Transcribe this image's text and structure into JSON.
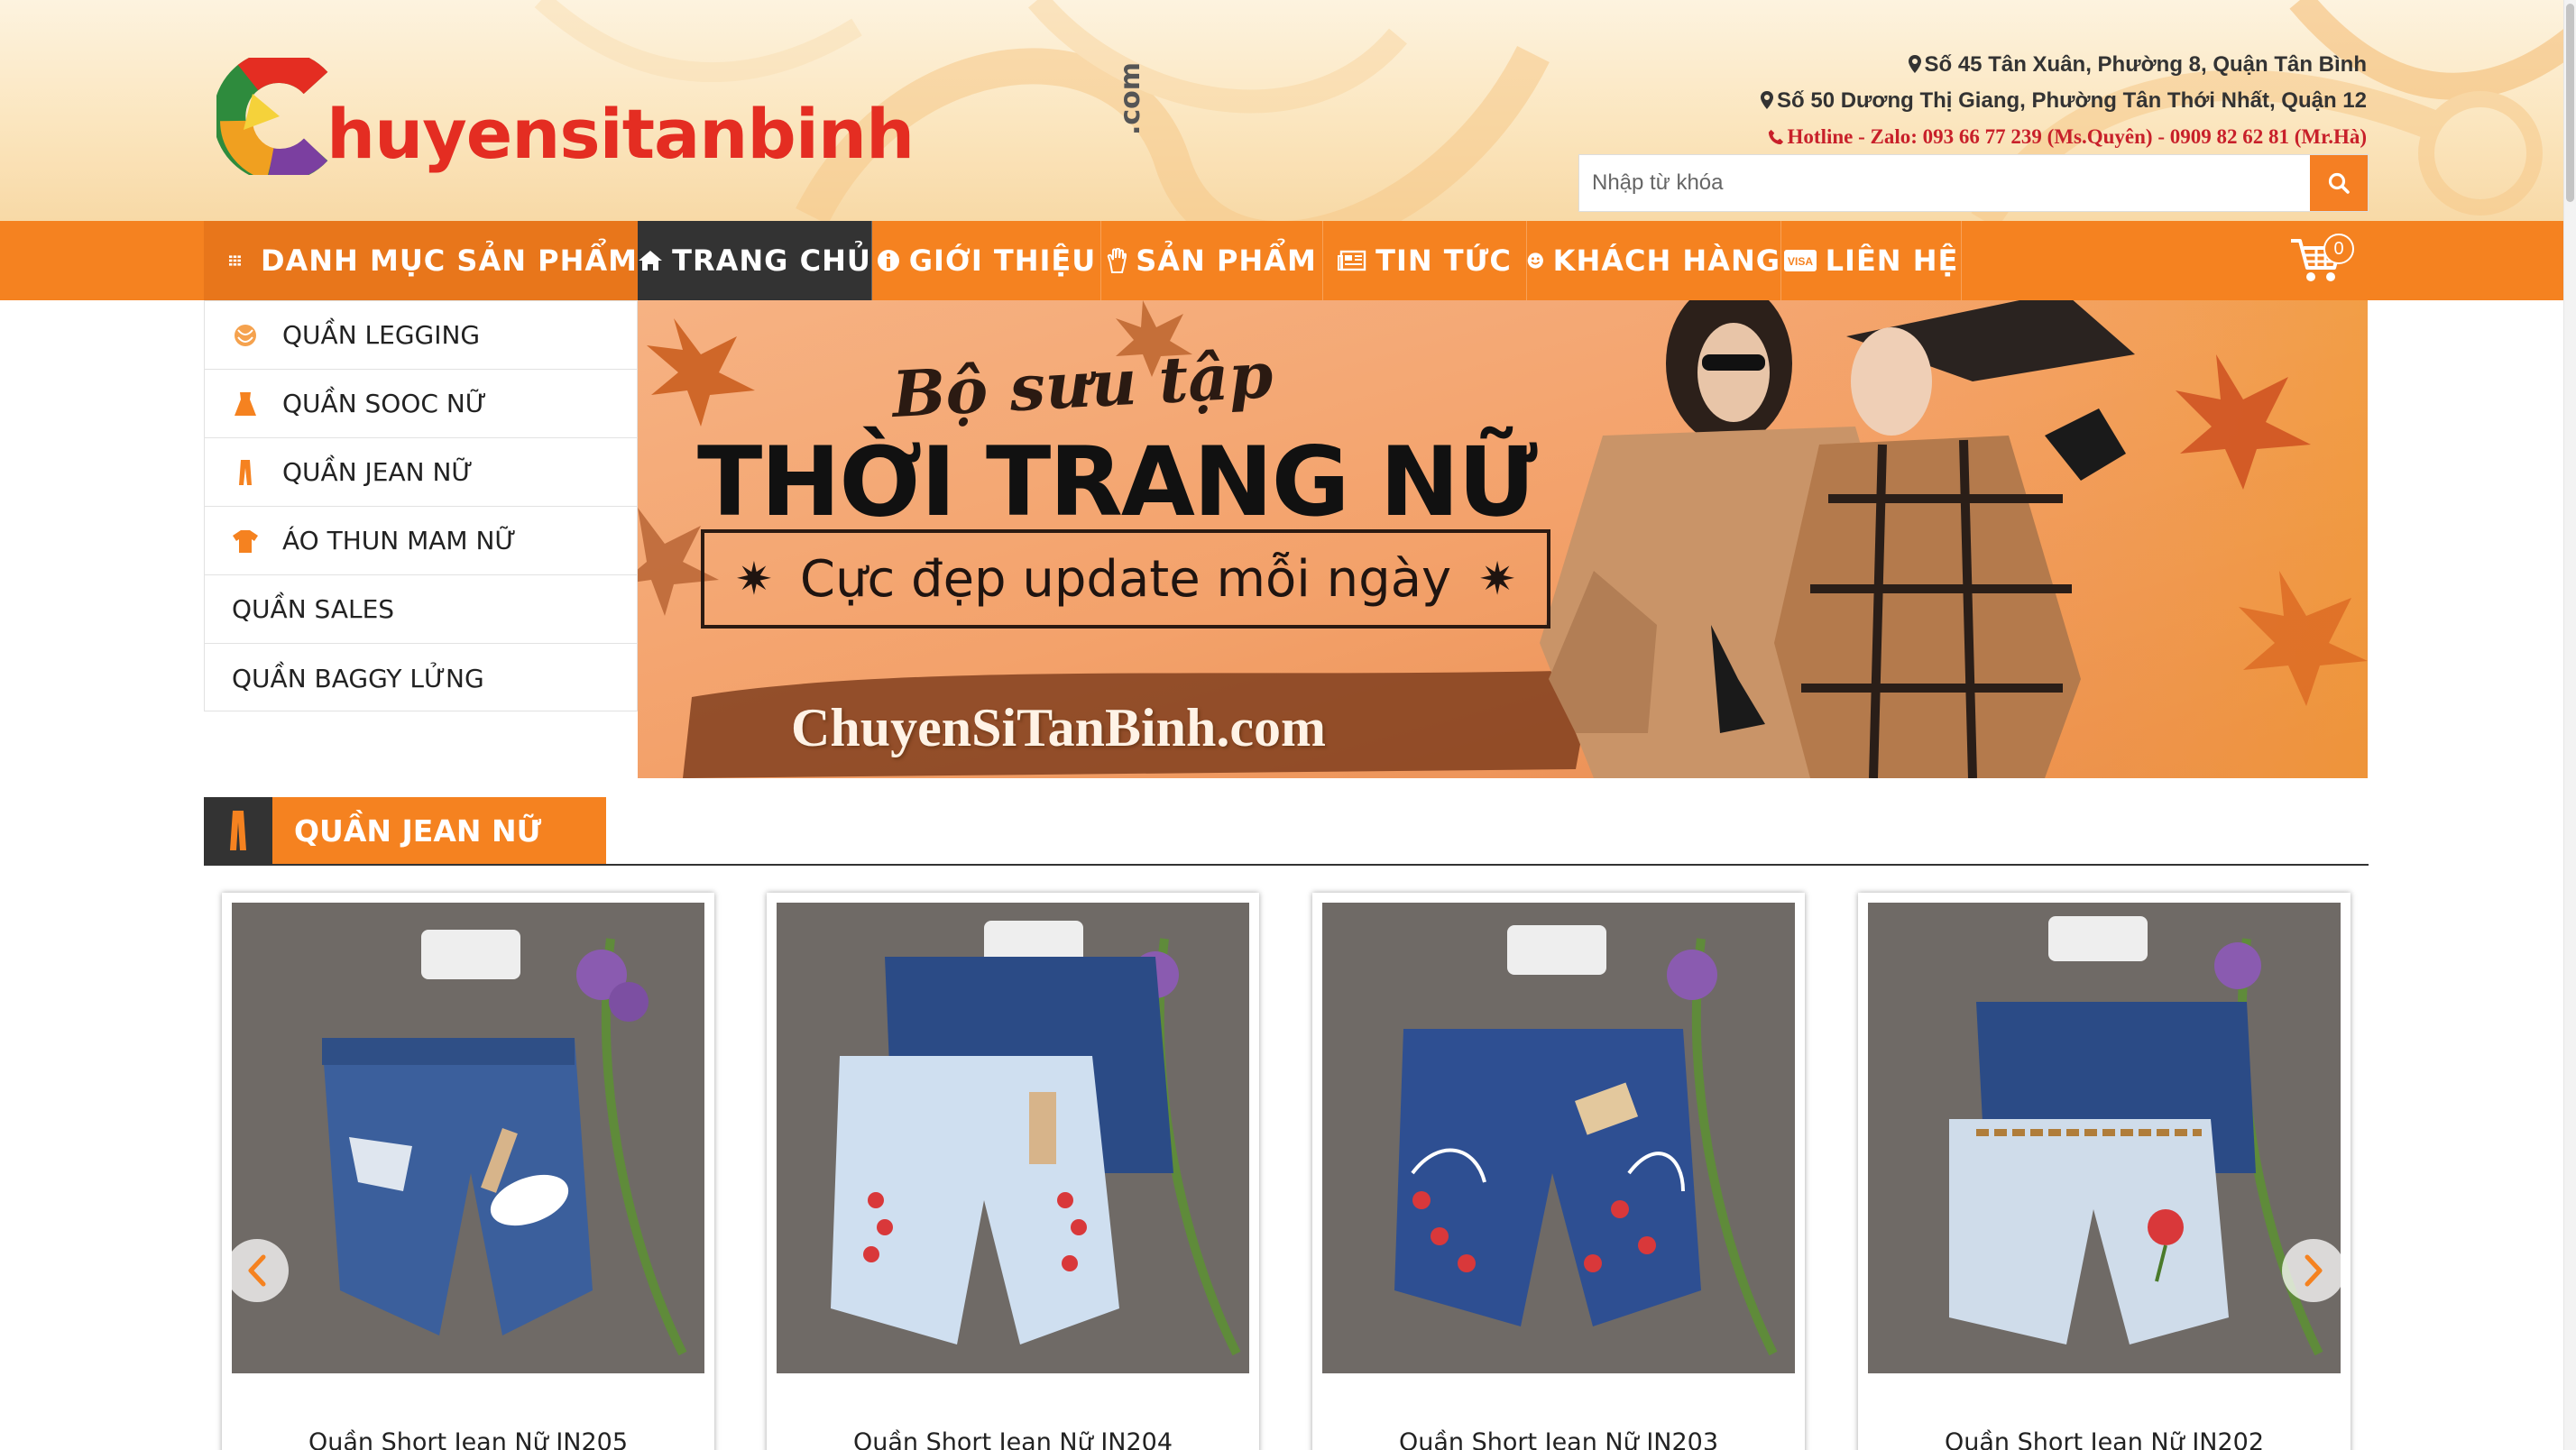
{
  "brand": {
    "logo_text": "huyensitanbinh",
    "logo_suffix": ".com",
    "primary_color": "#f58220",
    "accent_red": "#e42d22",
    "dark_color": "#333333"
  },
  "contact": {
    "address_1": "Số 45 Tân Xuân, Phường 8, Quận Tân Bình",
    "address_2": "Số 50 Dương Thị Giang, Phường Tân Thới Nhất, Quận 12",
    "hotline": "Hotline - Zalo: 093 66 77 239 (Ms.Quyên) - 0909 82 62 81 (Mr.Hà)"
  },
  "search": {
    "placeholder": "Nhập từ khóa",
    "value": ""
  },
  "nav": {
    "category_label": "DANH MỤC SẢN PHẨM",
    "items": [
      {
        "label": "TRANG CHỦ",
        "icon": "home-icon"
      },
      {
        "label": "GIỚI THIỆU",
        "icon": "info-icon"
      },
      {
        "label": "SẢN PHẨM",
        "icon": "hand-icon"
      },
      {
        "label": "TIN TỨC",
        "icon": "newspaper-icon"
      },
      {
        "label": "KHÁCH HÀNG",
        "icon": "smile-icon"
      },
      {
        "label": "LIÊN HỆ",
        "icon": "visa-card-icon"
      }
    ],
    "cart_count": "0"
  },
  "sidebar": {
    "items": [
      {
        "label": "QUẦN LEGGING",
        "icon": "legging-icon"
      },
      {
        "label": "QUẦN SOOC NỮ",
        "icon": "shorts-icon"
      },
      {
        "label": "QUẦN JEAN NỮ",
        "icon": "jeans-icon"
      },
      {
        "label": "ÁO THUN MAM NỮ",
        "icon": "tshirt-icon"
      },
      {
        "label": "QUẦN SALES",
        "icon": ""
      },
      {
        "label": "QUẦN BAGGY LỬNG",
        "icon": ""
      }
    ]
  },
  "banner": {
    "script": "Bộ sưu tập",
    "title": "THỜI TRANG NỮ",
    "tagline": "Cực đẹp update mỗi ngày",
    "site": "ChuyenSiTanBinh.com"
  },
  "section": {
    "title": "QUẦN JEAN NỮ"
  },
  "products": [
    {
      "name": "Quần Short Jean Nữ JN205"
    },
    {
      "name": "Quần Short Jean Nữ JN204"
    },
    {
      "name": "Quần Short Jean Nữ JN203"
    },
    {
      "name": "Quần Short Jean Nữ JN202"
    }
  ]
}
